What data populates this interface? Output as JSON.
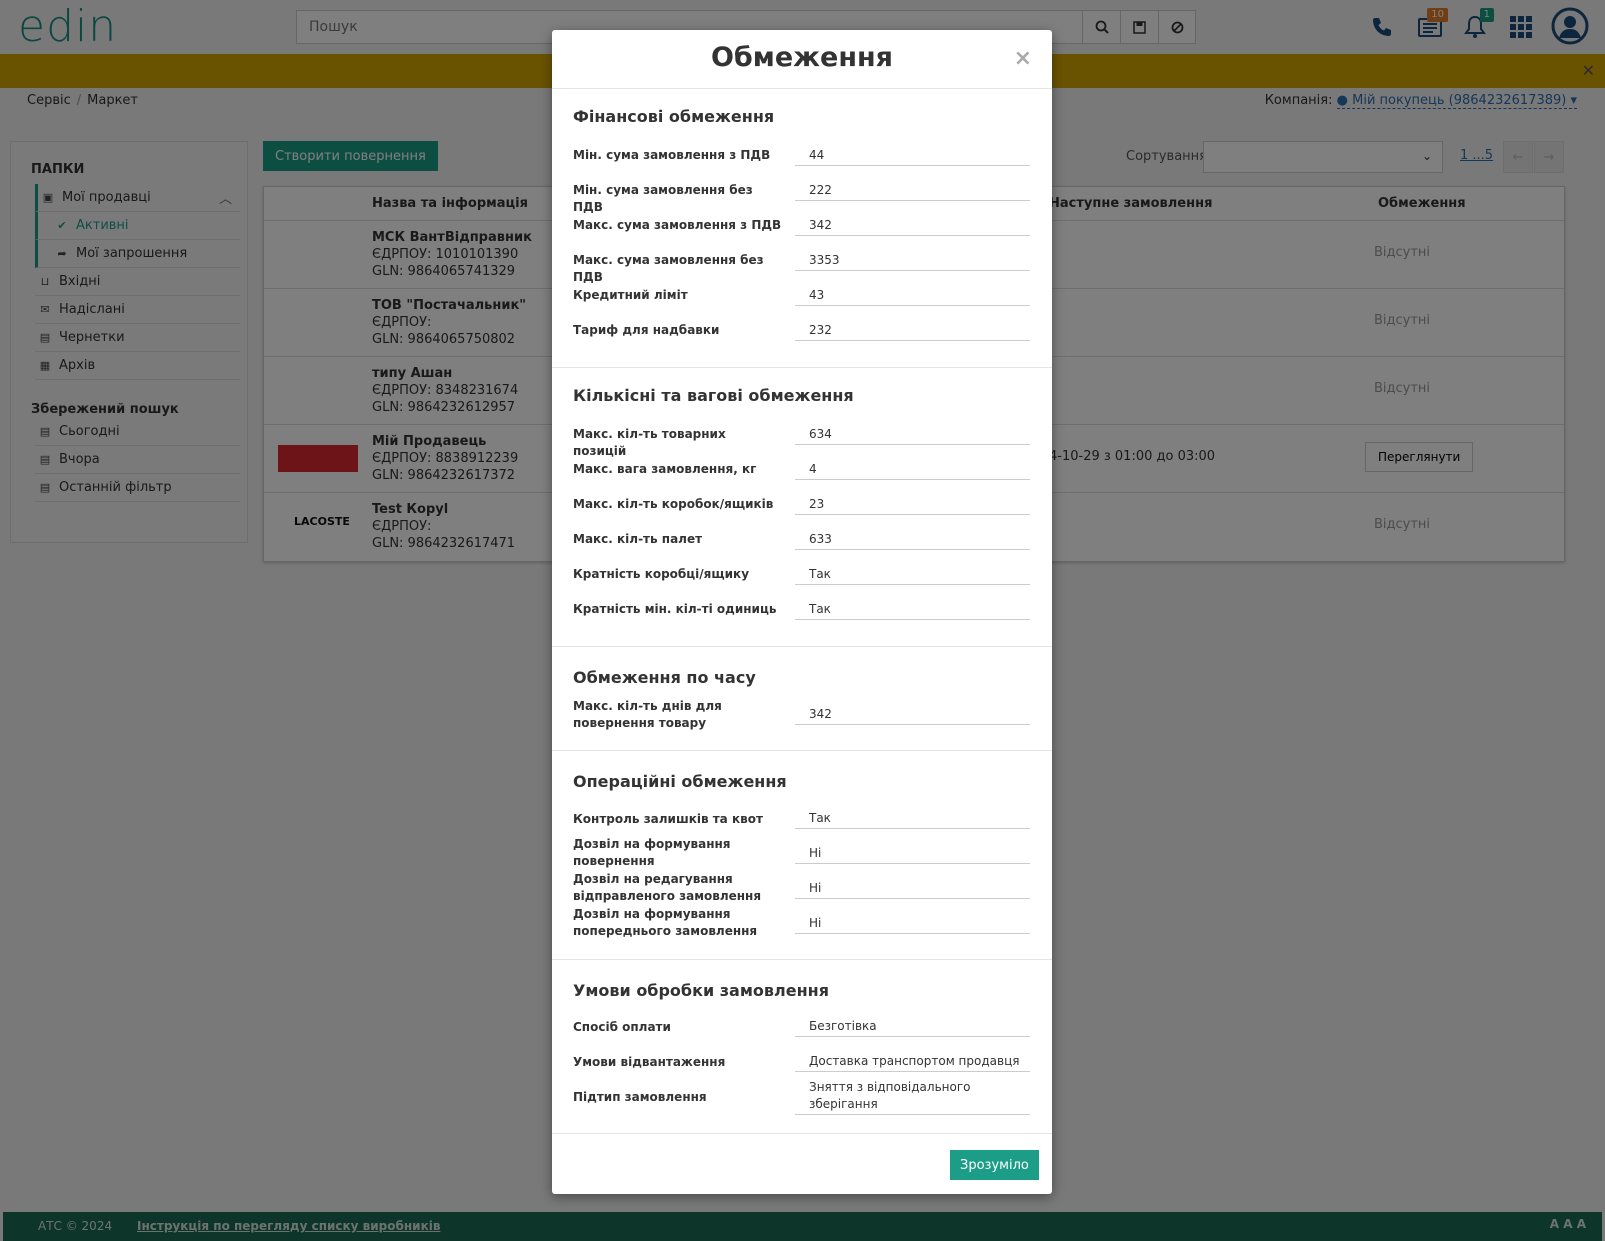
{
  "header": {
    "logo": "edin",
    "search_placeholder": "Пошук",
    "badge_docs": "10",
    "badge_notifications": "1"
  },
  "breadcrumb": {
    "items": [
      "Сервіс",
      "Маркет"
    ]
  },
  "company": {
    "label": "Компанія:",
    "value": "Мій покупець (9864232617389)"
  },
  "sidebar": {
    "folders_title": "ПАПКИ",
    "items": [
      {
        "label": "Мої продавці",
        "icon": "contact-book-icon"
      },
      {
        "label": "Активні",
        "icon": "check-icon"
      },
      {
        "label": "Мої запрошення",
        "icon": "share-icon"
      },
      {
        "label": "Вхідні",
        "icon": "inbox-icon"
      },
      {
        "label": "Надіслані",
        "icon": "envelope-icon"
      },
      {
        "label": "Чернетки",
        "icon": "document-icon"
      },
      {
        "label": "Архів",
        "icon": "archive-icon"
      }
    ],
    "saved_title": "Збережений пошук",
    "saved": [
      {
        "label": "Сьогодні"
      },
      {
        "label": "Вчора"
      },
      {
        "label": "Останній фільтр"
      }
    ]
  },
  "toolbar": {
    "create_return": "Створити повернення",
    "sort_label": "Сортування",
    "pager": "1 ...5"
  },
  "table": {
    "headers": [
      "Назва та інформація",
      "Наступне замовлення",
      "Обмеження"
    ],
    "rows": [
      {
        "name": "МСК ВантВідправник",
        "edrpou": "ЄДРПОУ: 1010101390",
        "gln": "GLN: 9864065741329",
        "next": "",
        "limit": "Відсутні"
      },
      {
        "name": "ТОВ \"Постачальник\"",
        "edrpou": "ЄДРПОУ:",
        "gln": "GLN: 9864065750802",
        "next": "",
        "limit": "Відсутні"
      },
      {
        "name": "типу Ашан",
        "edrpou": "ЄДРПОУ: 8348231674",
        "gln": "GLN: 9864232612957",
        "next": "",
        "limit": "Відсутні"
      },
      {
        "name": "Мій Продавець",
        "edrpou": "ЄДРПОУ: 8838912239",
        "gln": "GLN: 9864232617372",
        "next": "4-10-29  з  01:00  до  03:00",
        "limit": "Переглянути"
      },
      {
        "name": "Test Корyl",
        "edrpou": "ЄДРПОУ:",
        "gln": "GLN: 9864232617471",
        "next": "",
        "limit": "Відсутні",
        "logo": "LACOSTE"
      }
    ]
  },
  "modal": {
    "title": "Обмеження",
    "close": "×",
    "ok_button": "Зрозуміло",
    "financial": {
      "title": "Фінансові обмеження",
      "fields": [
        {
          "label": "Мін. сума замовлення з ПДВ",
          "value": "44"
        },
        {
          "label": "Мін. сума замовлення без ПДВ",
          "value": "222"
        },
        {
          "label": "Макс. сума замовлення з ПДВ",
          "value": "342"
        },
        {
          "label": "Макс. сума замовлення без ПДВ",
          "value": "3353"
        },
        {
          "label": "Кредитний ліміт",
          "value": "43"
        },
        {
          "label": "Тариф для надбавки",
          "value": "232"
        }
      ]
    },
    "quantity": {
      "title": "Кількісні та вагові обмеження",
      "fields": [
        {
          "label": "Макс. кіл-ть товарних позицій",
          "value": "634"
        },
        {
          "label": "Макс. вага замовлення, кг",
          "value": "4"
        },
        {
          "label": "Макс. кіл-ть коробок/ящиків",
          "value": "23"
        },
        {
          "label": "Макс. кіл-ть палет",
          "value": "633"
        },
        {
          "label": "Кратність коробці/ящику",
          "value": "Так"
        },
        {
          "label": "Кратність мін. кіл-ті одиниць",
          "value": "Так"
        }
      ]
    },
    "time": {
      "title": "Обмеження по часу",
      "fields": [
        {
          "label": "Макс. кіл-ть днів для повернення товару",
          "value": "342"
        }
      ]
    },
    "operational": {
      "title": "Операційні обмеження",
      "fields": [
        {
          "label": "Контроль залишків та квот",
          "value": "Так"
        },
        {
          "label": "Дозвіл на формування повернення",
          "value": "Ні"
        },
        {
          "label": "Дозвіл на редагування відправленого замовлення",
          "value": "Ні"
        },
        {
          "label": "Дозвіл на формування попереднього замовлення",
          "value": "Ні"
        }
      ]
    },
    "processing": {
      "title": "Умови обробки замовлення",
      "fields": [
        {
          "label": "Спосіб оплати",
          "value": "Безготівка"
        },
        {
          "label": "Умови відвантаження",
          "value": "Доставка транспортом продавця"
        },
        {
          "label": "Підтип замовлення",
          "value": "Зняття з відповідального зберігання"
        }
      ]
    }
  },
  "footer": {
    "copyright": "АТС © 2024",
    "link": "Інструкція по перегляду списку виробників",
    "sizes": "A A A"
  },
  "colors": {
    "accent": "#1b9d87",
    "warning_bar": "#d4a601",
    "footer": "#1a6b52",
    "link": "#2a6fb3"
  }
}
